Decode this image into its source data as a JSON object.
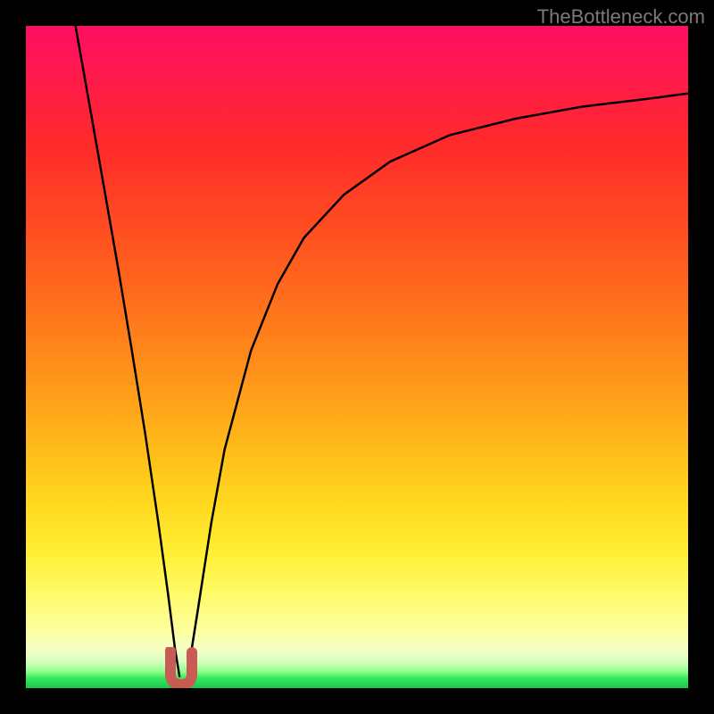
{
  "watermark": "TheBottleneck.com",
  "colors": {
    "page_bg": "#000000",
    "curve": "#000000",
    "u_marker": "#c95a54",
    "watermark": "#7a7a7a"
  },
  "chart_data": {
    "type": "line",
    "title": "",
    "xlabel": "",
    "ylabel": "",
    "xlim": [
      0,
      1
    ],
    "ylim": [
      0,
      1
    ],
    "grid": false,
    "legend": false,
    "background_gradient_stops": [
      {
        "pos": 0.0,
        "color": "#ff0f63"
      },
      {
        "pos": 0.18,
        "color": "#ff2a2a"
      },
      {
        "pos": 0.5,
        "color": "#ff8a1a"
      },
      {
        "pos": 0.72,
        "color": "#ffd81e"
      },
      {
        "pos": 0.91,
        "color": "#fdff9c"
      },
      {
        "pos": 0.97,
        "color": "#8fff8a"
      },
      {
        "pos": 1.0,
        "color": "#18c851"
      }
    ],
    "u_marker": {
      "x": 0.235,
      "bottom": 0.0,
      "color": "#c95a54"
    },
    "series": [
      {
        "name": "left_branch",
        "x": [
          0.075,
          0.09,
          0.105,
          0.12,
          0.14,
          0.16,
          0.18,
          0.2,
          0.215,
          0.225,
          0.232
        ],
        "values": [
          1.0,
          0.915,
          0.83,
          0.745,
          0.63,
          0.51,
          0.385,
          0.25,
          0.14,
          0.06,
          0.018
        ]
      },
      {
        "name": "right_branch",
        "x": [
          0.245,
          0.26,
          0.28,
          0.3,
          0.34,
          0.38,
          0.42,
          0.48,
          0.55,
          0.64,
          0.74,
          0.84,
          0.94,
          1.0
        ],
        "values": [
          0.025,
          0.12,
          0.25,
          0.36,
          0.51,
          0.61,
          0.68,
          0.745,
          0.795,
          0.835,
          0.86,
          0.878,
          0.89,
          0.898
        ]
      }
    ]
  }
}
